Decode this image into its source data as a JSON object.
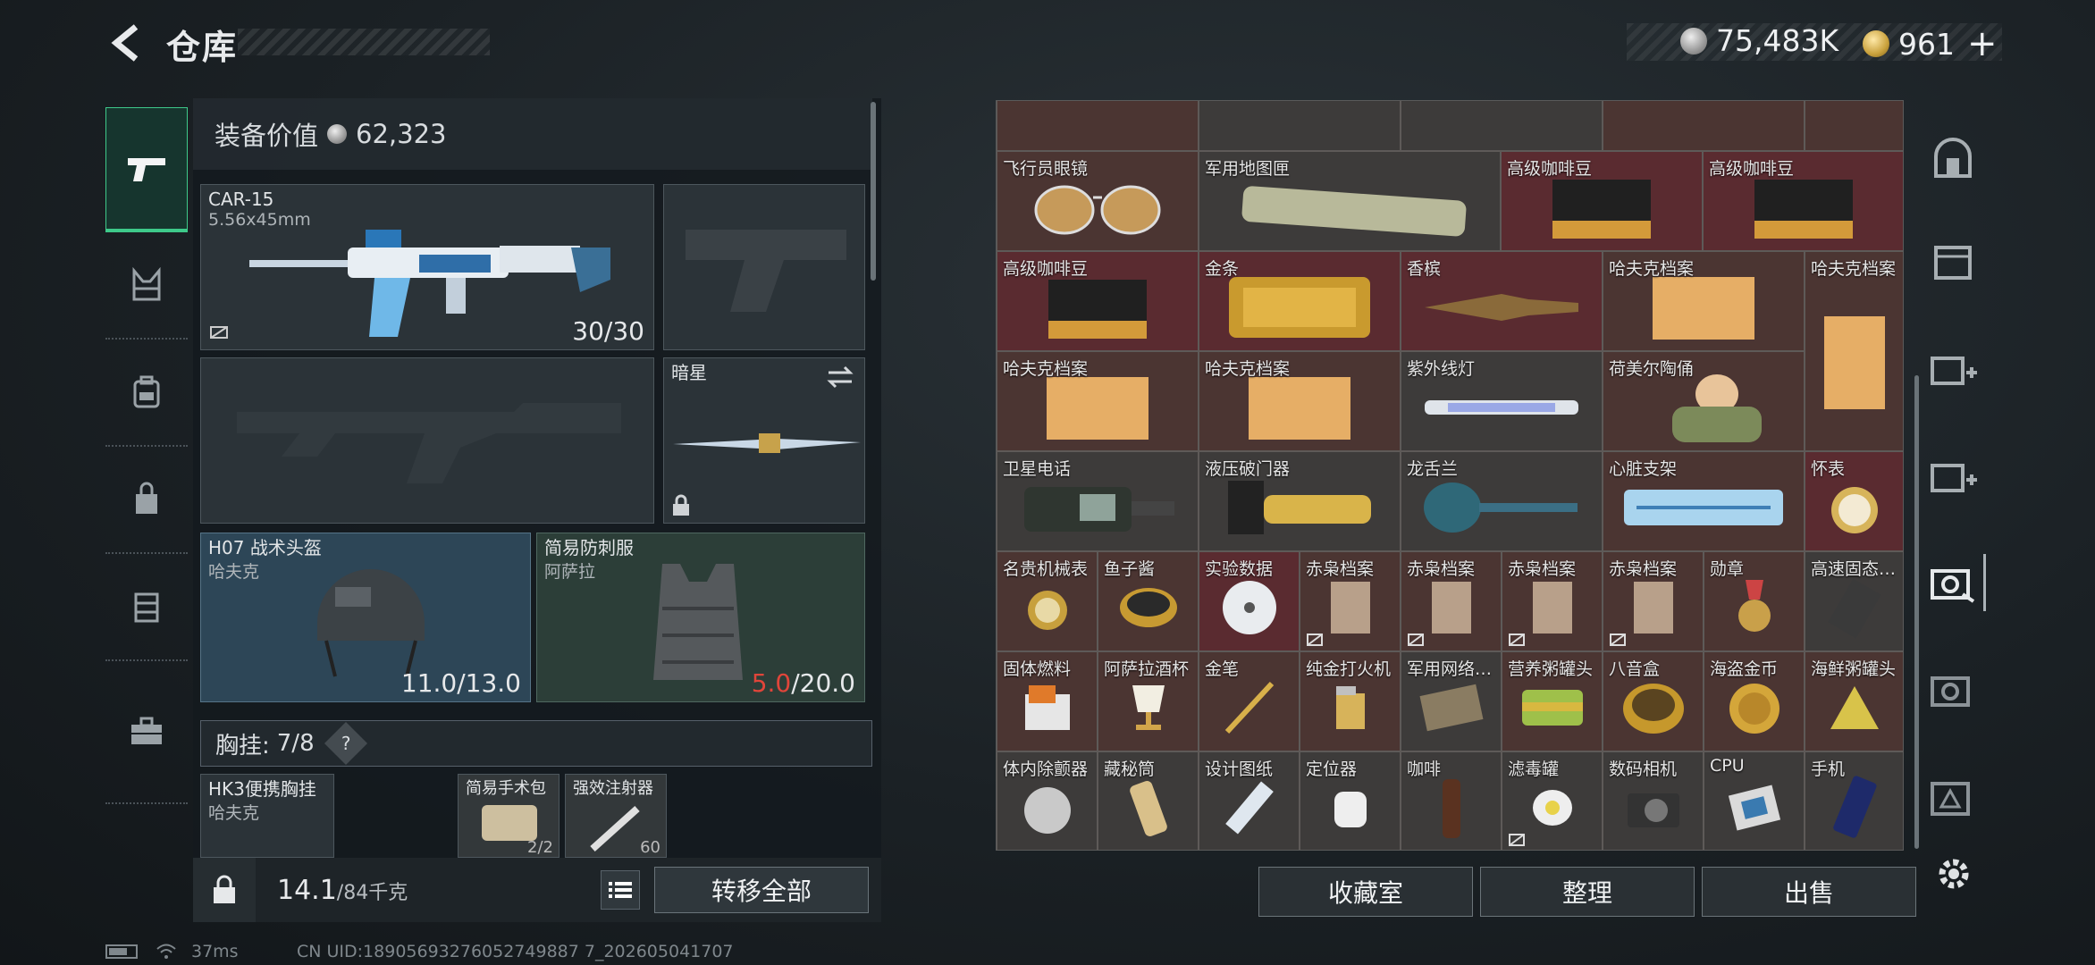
{
  "header": {
    "title": "仓库",
    "currency_silver": "75,483K",
    "currency_gold": "961"
  },
  "left_nav": {
    "items": [
      "pistol-icon",
      "chest-rig-icon",
      "backpack-icon",
      "pouch-icon",
      "armor-plate-icon",
      "case-icon"
    ]
  },
  "equipment": {
    "value_label": "装备价值",
    "value": "62,323",
    "primary": {
      "name": "CAR-15",
      "ammo_type": "5.56x45mm",
      "ammo": "30/30"
    },
    "melee": {
      "name": "暗星"
    },
    "helmet": {
      "name": "H07 战术头盔",
      "sub": "哈夫克",
      "durability": "11.0",
      "max": "/13.0"
    },
    "armor": {
      "name": "简易防刺服",
      "sub": "阿萨拉",
      "durability": "5.0",
      "max": "/20.0"
    },
    "chest_label": "胸挂:",
    "chest_count": "7/8",
    "chest_help": "?",
    "chest_items": [
      {
        "name": "HK3便携胸挂",
        "sub": "哈夫克"
      },
      {
        "name": "简易手术包",
        "count": "2/2"
      },
      {
        "name": "强效注射器",
        "count": "60"
      }
    ],
    "weight": "14.1",
    "weight_max": "/84千克",
    "transfer_all": "转移全部"
  },
  "storage": {
    "cells": [
      {
        "label": "飞行员眼镜",
        "bg": "c-brown"
      },
      {
        "label": "军用地图匣",
        "bg": "c-grey"
      },
      {
        "label": "高级咖啡豆",
        "bg": "c-red"
      },
      {
        "label": "高级咖啡豆",
        "bg": "c-red"
      },
      {
        "label": "高级咖啡豆",
        "bg": "c-red"
      },
      {
        "label": "金条",
        "bg": "c-red"
      },
      {
        "label": "香槟",
        "bg": "c-red"
      },
      {
        "label": "哈夫克档案",
        "bg": "c-brown"
      },
      {
        "label": "哈夫克档案",
        "bg": "c-brown"
      },
      {
        "label": "哈夫克档案",
        "bg": "c-brown"
      },
      {
        "label": "哈夫克档案",
        "bg": "c-brown"
      },
      {
        "label": "紫外线灯",
        "bg": "c-grey"
      },
      {
        "label": "荷美尔陶俑",
        "bg": "c-brown"
      },
      {
        "label": "卫星电话",
        "bg": "c-grey"
      },
      {
        "label": "液压破门器",
        "bg": "c-grey"
      },
      {
        "label": "龙舌兰",
        "bg": "c-grey"
      },
      {
        "label": "心脏支架",
        "bg": "c-brown"
      },
      {
        "label": "怀表",
        "bg": "c-red"
      },
      {
        "label": "名贵机械表",
        "bg": "c-brown"
      },
      {
        "label": "鱼子酱",
        "bg": "c-brown"
      },
      {
        "label": "实验数据",
        "bg": "c-red"
      },
      {
        "label": "赤枭档案",
        "bg": "c-brown"
      },
      {
        "label": "赤枭档案",
        "bg": "c-brown"
      },
      {
        "label": "赤枭档案",
        "bg": "c-brown"
      },
      {
        "label": "赤枭档案",
        "bg": "c-brown"
      },
      {
        "label": "勋章",
        "bg": "c-brown"
      },
      {
        "label": "高速固态…",
        "bg": "c-grey"
      },
      {
        "label": "固体燃料",
        "bg": "c-brown"
      },
      {
        "label": "阿萨拉酒杯",
        "bg": "c-brown"
      },
      {
        "label": "金笔",
        "bg": "c-brown"
      },
      {
        "label": "纯金打火机",
        "bg": "c-brown"
      },
      {
        "label": "军用网络…",
        "bg": "c-grey"
      },
      {
        "label": "营养粥罐头",
        "bg": "c-brown"
      },
      {
        "label": "八音盒",
        "bg": "c-brown"
      },
      {
        "label": "海盗金币",
        "bg": "c-brown"
      },
      {
        "label": "海鲜粥罐头",
        "bg": "c-brown"
      },
      {
        "label": "体内除颤器",
        "bg": "c-grey"
      },
      {
        "label": "藏秘筒",
        "bg": "c-grey"
      },
      {
        "label": "设计图纸",
        "bg": "c-grey"
      },
      {
        "label": "定位器",
        "bg": "c-grey"
      },
      {
        "label": "咖啡",
        "bg": "c-grey"
      },
      {
        "label": "滤毒罐",
        "bg": "c-grey"
      },
      {
        "label": "数码相机",
        "bg": "c-grey"
      },
      {
        "label": "CPU",
        "bg": "c-grey"
      },
      {
        "label": "手机",
        "bg": "c-grey"
      }
    ]
  },
  "actions": {
    "collection_room": "收藏室",
    "sort": "整理",
    "sell": "出售"
  },
  "status": {
    "ping": "37ms",
    "uid": "CN UID:18905693276052749887 7_202605041707"
  },
  "colors": {
    "accent_green": "#3ec98a",
    "durability_low": "#e0453a",
    "rare_red_bg": "#5a2b30"
  }
}
